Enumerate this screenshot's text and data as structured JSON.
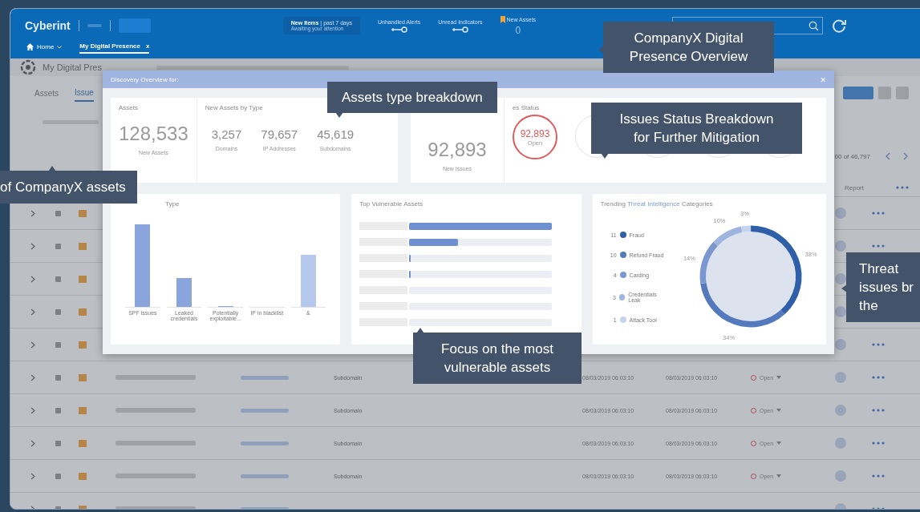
{
  "header": {
    "logo": "Cyberint",
    "counters": [
      {
        "kind": "items",
        "title": "New Items",
        "subtitle": "| past 7 days",
        "note": "Awaiting your attention"
      },
      {
        "kind": "key",
        "title": "Unhandled Alerts"
      },
      {
        "kind": "key",
        "title": "Unread Indicators"
      },
      {
        "kind": "flag",
        "title": "New Assets",
        "value": "0"
      }
    ],
    "nav": [
      {
        "label": "Home",
        "kind": "home",
        "selected": false
      },
      {
        "label": "My Digital Presence",
        "close": "x",
        "kind": "tab",
        "selected": true
      }
    ]
  },
  "breadcrumb": {
    "title": "My Digital Pres"
  },
  "page_tabs": [
    {
      "label": "Assets",
      "selected": false
    },
    {
      "label": "Issue",
      "selected": true
    }
  ],
  "pagination": "00 of 46,797",
  "table": {
    "column_report": "Report",
    "rows": [
      {},
      {},
      {},
      {},
      {},
      {
        "type": "Subdomain",
        "created": "08/03/2019 06:03:10",
        "updated": "08/03/2019 06:03:10",
        "status": "Open"
      },
      {
        "type": "Subdomain",
        "created": "08/03/2019 06:03:10",
        "updated": "08/03/2019 06:03:10",
        "status": "Open"
      },
      {
        "type": "Subdomain",
        "created": "08/03/2019 06:03:10",
        "updated": "08/03/2019 06:03:10",
        "status": "Open"
      },
      {
        "type": "Subdomain",
        "created": "08/03/2019 06:03:10",
        "updated": "08/03/2019 06:03:10",
        "status": "Open"
      },
      {}
    ]
  },
  "modal": {
    "title": "Discovery Overview for:",
    "close": "×",
    "assets": {
      "title": "Assets",
      "value": "128,533",
      "label": "New Assets"
    },
    "by_type": {
      "title": "New Assets by Type",
      "items": [
        {
          "value": "3,257",
          "label": "Domains"
        },
        {
          "value": "79,657",
          "label": "IP Addresses"
        },
        {
          "value": "45,619",
          "label": "Subdomains"
        }
      ]
    },
    "issues": {
      "value": "92,893",
      "label": "New Issues"
    },
    "status": {
      "title": "es Status",
      "circles": [
        {
          "value": "92,893",
          "label": "Open",
          "kind": "open"
        },
        {
          "kind": "blank"
        },
        {
          "kind": "blank"
        },
        {
          "kind": "blank"
        },
        {
          "kind": "blank"
        }
      ]
    },
    "issues_by_type": {
      "title": "Type",
      "categories": [
        "SPF issues",
        "Leaked credentials",
        "Potentially exploitable...",
        "IP in blacklist",
        "&"
      ]
    },
    "vulnerable": {
      "title": "Top Vulnerable Assets"
    },
    "trending": {
      "title_start": "Trending ",
      "title_link": "Threat Intelligence",
      "title_end": " Categories",
      "legend": [
        {
          "count": "11",
          "color": "#2f5fa8"
        },
        {
          "count": "10",
          "color": "#5579bd"
        },
        {
          "count": "4",
          "color": "#7b97cf"
        },
        {
          "count": "3",
          "color": "#9fb4de"
        },
        {
          "count": "1",
          "color": "#c6d3ec"
        }
      ],
      "chart_data": {
        "type": "donut",
        "categories": [
          "Fraud",
          "Refund Fraud",
          "Carding",
          "Credentials Leak",
          "Attack Tool"
        ],
        "values": [
          38,
          34,
          14,
          10,
          3
        ],
        "value_labels": [
          "38%",
          "34%",
          "14%",
          "10%",
          "3%"
        ]
      }
    }
  },
  "callouts": [
    {
      "kind": "top",
      "lines": [
        "CompanyX Digital",
        "Presence Overview"
      ]
    },
    {
      "kind": "types",
      "lines": [
        "Assets type breakdown"
      ]
    },
    {
      "kind": "status",
      "lines": [
        "Issues Status Breakdown",
        "for Further Mitigation"
      ]
    },
    {
      "kind": "assets",
      "lines": [
        "of CompanyX assets"
      ]
    },
    {
      "kind": "threat",
      "lines": [
        "Threat",
        "issues br",
        "the"
      ]
    },
    {
      "kind": "focus",
      "lines": [
        "Focus on the most",
        "vulnerable assets"
      ]
    }
  ]
}
